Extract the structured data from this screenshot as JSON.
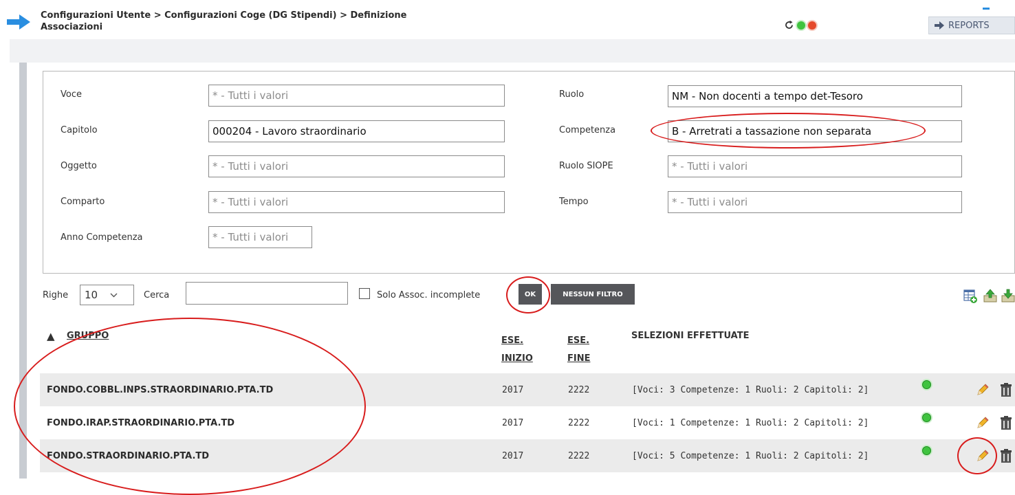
{
  "header": {
    "breadcrumb_line1": "Configurazioni Utente > Configurazioni Coge (DG Stipendi) > Definizione",
    "breadcrumb_line2": "Associazioni",
    "reports_label": "REPORTS"
  },
  "filters": {
    "voce": {
      "label": "Voce",
      "value": "* - Tutti i valori"
    },
    "capitolo": {
      "label": "Capitolo",
      "value": "000204 - Lavoro straordinario"
    },
    "oggetto": {
      "label": "Oggetto",
      "value": "* - Tutti i valori"
    },
    "comparto": {
      "label": "Comparto",
      "value": "* - Tutti i valori"
    },
    "anno_competenza": {
      "label": "Anno Competenza",
      "value": "* - Tutti i valori"
    },
    "ruolo": {
      "label": "Ruolo",
      "value": "NM - Non docenti a tempo det-Tesoro"
    },
    "competenza": {
      "label": "Competenza",
      "value": "B - Arretrati a tassazione non separata"
    },
    "ruolo_siope": {
      "label": "Ruolo SIOPE",
      "value": "* - Tutti i valori"
    },
    "tempo": {
      "label": "Tempo",
      "value": "* - Tutti i valori"
    }
  },
  "toolbar": {
    "righe_label": "Righe",
    "righe_value": "10",
    "cerca_label": "Cerca",
    "cerca_value": "",
    "solo_label": "Solo Assoc. incomplete",
    "ok_label": "OK",
    "nessun_filtro_label": "NESSUN FILTRO"
  },
  "table": {
    "sort_indicator": "▲",
    "headers": {
      "gruppo": "GRUPPO",
      "ese_inizio_1": "ESE.",
      "ese_inizio_2": "INIZIO",
      "ese_fine_1": "ESE.",
      "ese_fine_2": "FINE",
      "selezioni": "SELEZIONI EFFETTUATE"
    },
    "rows": [
      {
        "gruppo": "FONDO.COBBL.INPS.STRAORDINARIO.PTA.TD",
        "inizio": "2017",
        "fine": "2222",
        "selezioni": "[Voci: 3 Competenze: 1 Ruoli: 2 Capitoli: 2]"
      },
      {
        "gruppo": "FONDO.IRAP.STRAORDINARIO.PTA.TD",
        "inizio": "2017",
        "fine": "2222",
        "selezioni": "[Voci: 1 Competenze: 1 Ruoli: 2 Capitoli: 2]"
      },
      {
        "gruppo": "FONDO.STRAORDINARIO.PTA.TD",
        "inizio": "2017",
        "fine": "2222",
        "selezioni": "[Voci: 5 Competenze: 1 Ruoli: 2 Capitoli: 2]"
      }
    ]
  },
  "colors": {
    "accent_blue": "#2a8ee0",
    "status_green": "#3fc33f",
    "status_red": "#e5492b",
    "annotation_red": "#d81c1c"
  }
}
